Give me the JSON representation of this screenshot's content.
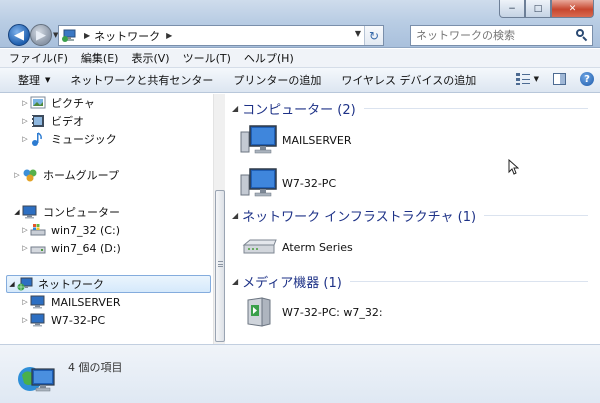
{
  "window": {
    "minimize": "−",
    "maximize": "□",
    "close": "✕"
  },
  "address": {
    "location": "ネットワーク",
    "separator_arrow": "▶",
    "dropdown_arrow": "▼"
  },
  "search": {
    "placeholder": "ネットワークの検索"
  },
  "menu": [
    "ファイル(F)",
    "編集(E)",
    "表示(V)",
    "ツール(T)",
    "ヘルプ(H)"
  ],
  "toolbar": {
    "organize": "整理",
    "network_sharing": "ネットワークと共有センター",
    "add_printer": "プリンターの追加",
    "add_wireless": "ワイヤレス デバイスの追加",
    "help": "?"
  },
  "navpane": {
    "pictures": "ピクチャ",
    "video": "ビデオ",
    "music": "ミュージック",
    "homegroup": "ホームグループ",
    "computer": "コンピューター",
    "drive_c": "win7_32 (C:)",
    "drive_d": "win7_64 (D:)",
    "network": "ネットワーク",
    "mailserver": "MAILSERVER",
    "w7pc": "W7-32-PC"
  },
  "content": {
    "groups": [
      {
        "header": "コンピューター (2)",
        "items": [
          "MAILSERVER",
          "W7-32-PC"
        ]
      },
      {
        "header": "ネットワーク インフラストラクチャ (1)",
        "items": [
          "Aterm Series"
        ]
      },
      {
        "header": "メディア機器 (1)",
        "items": [
          "W7-32-PC: w7_32:"
        ]
      }
    ]
  },
  "status": {
    "item_count": "4 個の項目"
  },
  "icons": {
    "back": "back-arrow-icon",
    "forward": "forward-arrow-icon",
    "refresh": "refresh-icon",
    "search": "search-icon",
    "views": "views-icon",
    "preview_pane": "preview-pane-icon",
    "help": "help-icon"
  },
  "colors": {
    "group_header": "#1e3287",
    "selection_border": "#84acdd",
    "title_gradient_top": "#cfdcec",
    "title_gradient_bottom": "#a9c0dc"
  }
}
